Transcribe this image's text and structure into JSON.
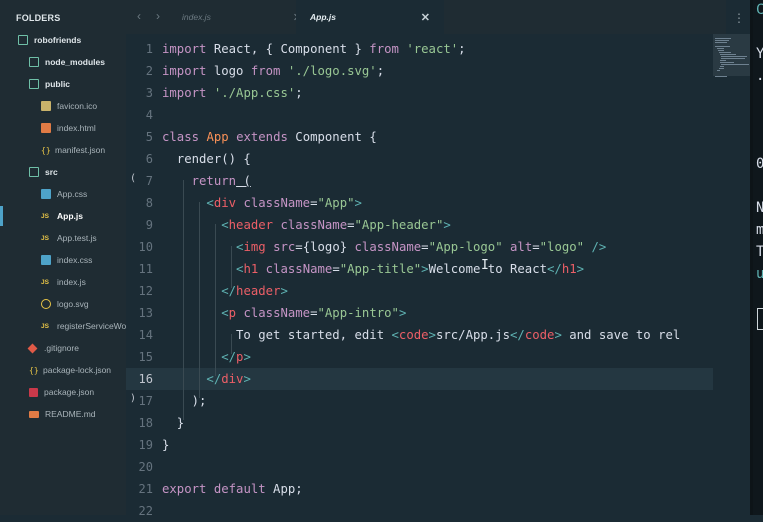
{
  "sidebar": {
    "header": "FOLDERS",
    "items": [
      {
        "label": "robofriends",
        "kind": "folder"
      },
      {
        "label": "node_modules",
        "kind": "folder"
      },
      {
        "label": "public",
        "kind": "folder"
      },
      {
        "label": "favicon.ico",
        "kind": "image"
      },
      {
        "label": "index.html",
        "kind": "html"
      },
      {
        "label": "manifest.json",
        "kind": "json"
      },
      {
        "label": "src",
        "kind": "folder"
      },
      {
        "label": "App.css",
        "kind": "css"
      },
      {
        "label": "App.js",
        "kind": "js"
      },
      {
        "label": "App.test.js",
        "kind": "js"
      },
      {
        "label": "index.css",
        "kind": "css"
      },
      {
        "label": "index.js",
        "kind": "js"
      },
      {
        "label": "logo.svg",
        "kind": "svg"
      },
      {
        "label": "registerServiceWorker.js",
        "kind": "js"
      },
      {
        "label": ".gitignore",
        "kind": "git"
      },
      {
        "label": "package-lock.json",
        "kind": "json"
      },
      {
        "label": "package.json",
        "kind": "npm"
      },
      {
        "label": "README.md",
        "kind": "md"
      }
    ]
  },
  "tabs": {
    "prev_icon": "‹",
    "next_icon": "›",
    "items": [
      {
        "label": "index.js",
        "close": "✕"
      },
      {
        "label": "App.js",
        "close": "✕"
      }
    ]
  },
  "editor": {
    "current_line": 16,
    "line_numbers": [
      "1",
      "2",
      "3",
      "4",
      "5",
      "6",
      "7",
      "8",
      "9",
      "10",
      "11",
      "12",
      "13",
      "14",
      "15",
      "16",
      "17",
      "18",
      "19",
      "20",
      "21",
      "22"
    ]
  },
  "code": {
    "l1": {
      "a": "import",
      "b": " React, { Component } ",
      "c": "from",
      "d": " ",
      "e": "'react'",
      "f": ";"
    },
    "l2": {
      "a": "import",
      "b": " logo ",
      "c": "from",
      "d": " ",
      "e": "'./logo.svg'",
      "f": ";"
    },
    "l3": {
      "a": "import",
      "b": " ",
      "e": "'./App.css'",
      "f": ";"
    },
    "l5": {
      "a": "class",
      "b": " ",
      "c": "App",
      "d": " ",
      "e": "extends",
      "f": " Component {"
    },
    "l6": {
      "a": "  render() {"
    },
    "l7": {
      "a": "    ",
      "b": "return",
      "c": " ("
    },
    "l8": {
      "a": "      ",
      "b": "<",
      "c": "div",
      "d": " ",
      "e": "className",
      "f": "=",
      "g": "\"App\"",
      "h": ">"
    },
    "l9": {
      "a": "        ",
      "b": "<",
      "c": "header",
      "d": " ",
      "e": "className",
      "f": "=",
      "g": "\"App-header\"",
      "h": ">"
    },
    "l10": {
      "a": "          ",
      "b": "<",
      "c": "img",
      "d": " ",
      "e": "src",
      "f": "={logo} ",
      "g": "className",
      "h": "=",
      "i": "\"App-logo\"",
      "j": " ",
      "k": "alt",
      "l": "=",
      "m": "\"logo\"",
      "n": " />"
    },
    "l11": {
      "a": "          ",
      "b": "<",
      "c": "h1",
      "d": " ",
      "e": "className",
      "f": "=",
      "g": "\"App-title\"",
      "h": ">",
      "i": "Welcome to React",
      "j": "</",
      "k": "h1",
      "l": ">"
    },
    "l12": {
      "a": "        ",
      "b": "</",
      "c": "header",
      "d": ">"
    },
    "l13": {
      "a": "        ",
      "b": "<",
      "c": "p",
      "d": " ",
      "e": "className",
      "f": "=",
      "g": "\"App-intro\"",
      "h": ">"
    },
    "l14": {
      "a": "          To get started, edit ",
      "b": "<",
      "c": "code",
      "d": ">",
      "e": "src/App.js",
      "f": "</",
      "g": "code",
      "h": ">",
      "i": " and save to rel"
    },
    "l15": {
      "a": "        ",
      "b": "</",
      "c": "p",
      "d": ">"
    },
    "l16": {
      "a": "      ",
      "b": "</",
      "c": "div",
      "d": ">"
    },
    "l17": {
      "a": "    );"
    },
    "l18": {
      "a": "  }"
    },
    "l19": {
      "a": "}"
    },
    "l21": {
      "a": "export",
      "b": " ",
      "c": "default",
      "d": " App;"
    }
  },
  "right_pane": {
    "lines": [
      {
        "text": "C",
        "color": "#5fb3b3"
      },
      {
        "text": "Y",
        "color": "#d8dee9"
      },
      {
        "text": ".",
        "color": "#d8dee9"
      },
      {
        "text": "0",
        "color": "#d8dee9"
      },
      {
        "text": "N",
        "color": "#d8dee9"
      },
      {
        "text": "m",
        "color": "#d8dee9"
      },
      {
        "text": "T",
        "color": "#d8dee9"
      },
      {
        "text": "u",
        "color": "#5fb3b3"
      }
    ]
  },
  "gutter_marks": {
    "open": "(",
    "close": ")"
  },
  "menu_icon": "⋮",
  "cursor_glyph": "I"
}
